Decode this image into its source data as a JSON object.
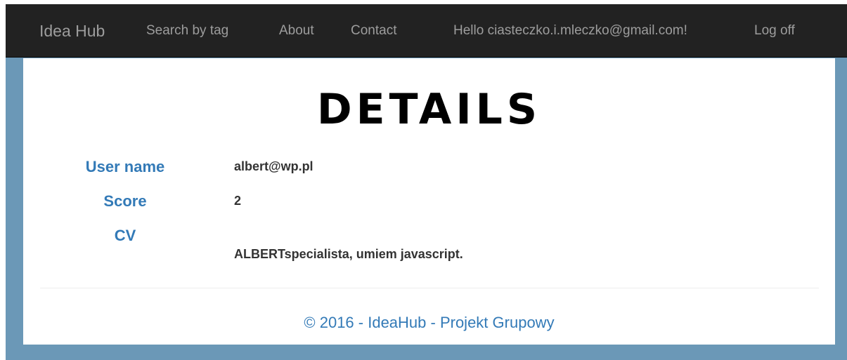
{
  "navbar": {
    "brand": "Idea Hub",
    "links": [
      "Search by tag",
      "About",
      "Contact"
    ],
    "greeting": "Hello ciasteczko.i.mleczko@gmail.com!",
    "logoff": "Log off"
  },
  "colors": {
    "navbar_bg": "#222222",
    "page_bg": "#6b98b7",
    "accent": "#337ab7"
  },
  "main": {
    "title": "Details",
    "fields": [
      {
        "label": "User name",
        "value": "albert@wp.pl"
      },
      {
        "label": "Score",
        "value": "2"
      },
      {
        "label": "CV",
        "value": "ALBERTspecialista, umiem javascript."
      }
    ]
  },
  "footer": {
    "text": "© 2016 - IdeaHub - Projekt Grupowy"
  }
}
